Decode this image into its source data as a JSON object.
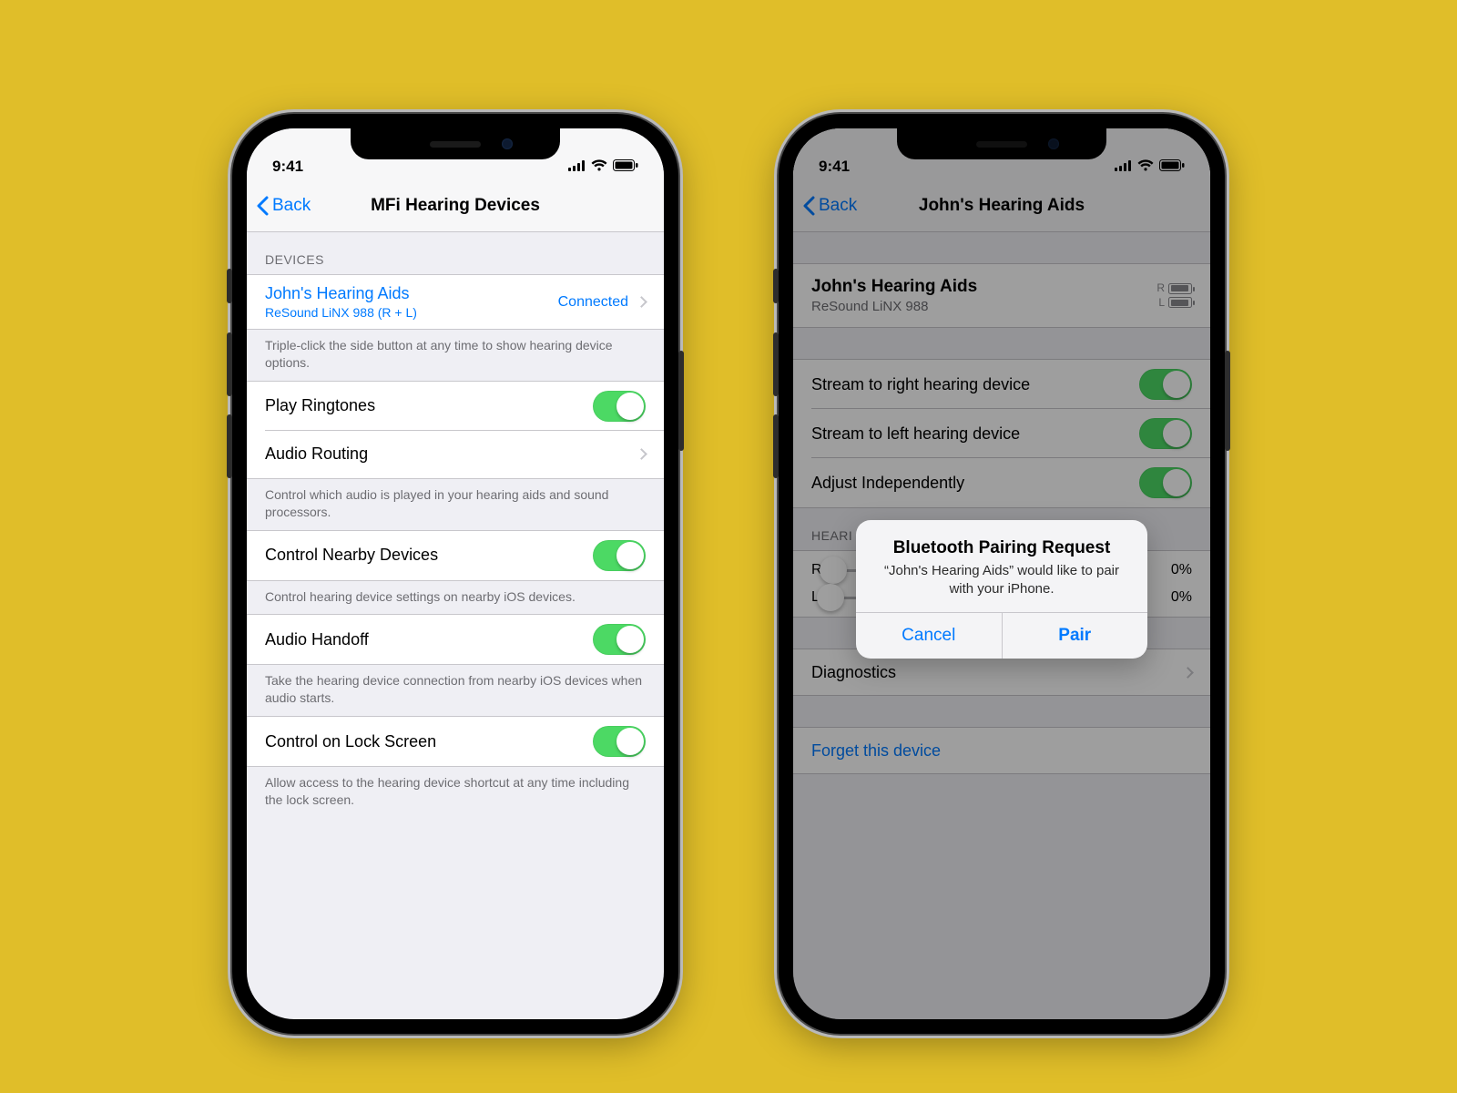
{
  "status_time": "9:41",
  "back_label": "Back",
  "left": {
    "title": "MFi Hearing Devices",
    "devices_header": "DEVICES",
    "device": {
      "name": "John's Hearing Aids",
      "model": "ReSound LiNX 988 (R + L)",
      "status": "Connected"
    },
    "devices_footer": "Triple-click the side button at any time to show hearing device options.",
    "rows": {
      "play_ringtones": "Play Ringtones",
      "audio_routing": "Audio Routing",
      "audio_routing_footer": "Control which audio is played in your hearing aids and sound processors.",
      "control_nearby": "Control Nearby Devices",
      "control_nearby_footer": "Control hearing device settings on nearby iOS devices.",
      "audio_handoff": "Audio Handoff",
      "audio_handoff_footer": "Take the hearing device connection from nearby iOS devices when audio starts.",
      "lock_screen": "Control on Lock Screen",
      "lock_screen_footer": "Allow access to the hearing device shortcut at any time including the lock screen."
    }
  },
  "right": {
    "title": "John's Hearing Aids",
    "device": {
      "name": "John's Hearing Aids",
      "model": "ReSound LiNX 988",
      "r_label": "R",
      "l_label": "L"
    },
    "stream_right": "Stream to right hearing device",
    "stream_left": "Stream to left hearing device",
    "adjust_independently": "Adjust Independently",
    "hearing_header_partial": "HEARI",
    "slider_r": "R",
    "slider_l": "L",
    "slider_r_pct": "0%",
    "slider_l_pct": "0%",
    "diagnostics": "Diagnostics",
    "forget": "Forget this device",
    "alert": {
      "title": "Bluetooth Pairing Request",
      "message": "“John's Hearing Aids” would like to pair with your iPhone.",
      "cancel": "Cancel",
      "pair": "Pair"
    }
  }
}
